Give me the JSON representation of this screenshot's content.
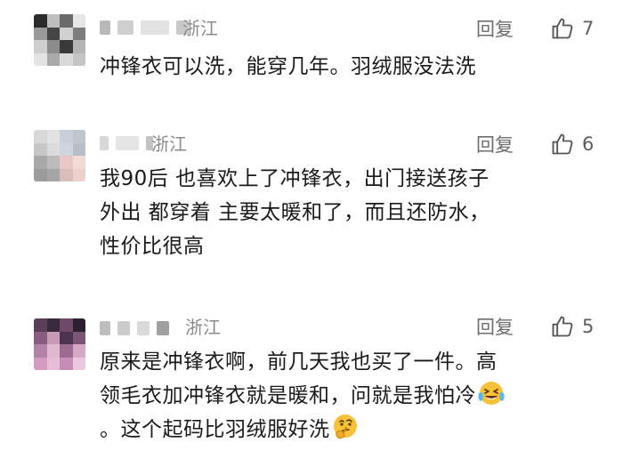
{
  "comments": [
    {
      "location": "浙江",
      "reply_label": "回复",
      "like_count": "7",
      "lines": [
        "冲锋衣可以洗，能穿几年。羽绒服没法洗"
      ]
    },
    {
      "location": "浙江",
      "reply_label": "回复",
      "like_count": "6",
      "lines": [
        "我90后 也喜欢上了冲锋衣，出门接送孩子",
        "外出 都穿着 主要太暖和了，而且还防水，",
        "性价比很高"
      ]
    },
    {
      "location": "浙江",
      "reply_label": "回复",
      "like_count": "5",
      "lines": [
        "原来是冲锋衣啊，前几天我也买了一件。高",
        "领毛衣加冲锋衣就是暖和，问就是我怕冷",
        "。这个起码比羽绒服好洗"
      ],
      "emojis": [
        "laughing-crying-emoji",
        "thinking-emoji"
      ]
    }
  ],
  "icons": {
    "like": "thumbs-up-icon"
  },
  "colors": {
    "text": "#1a1a1a",
    "meta": "#8a8a8a",
    "reply": "#6d6d6d",
    "emoji_yellow": "#f7c23a"
  }
}
